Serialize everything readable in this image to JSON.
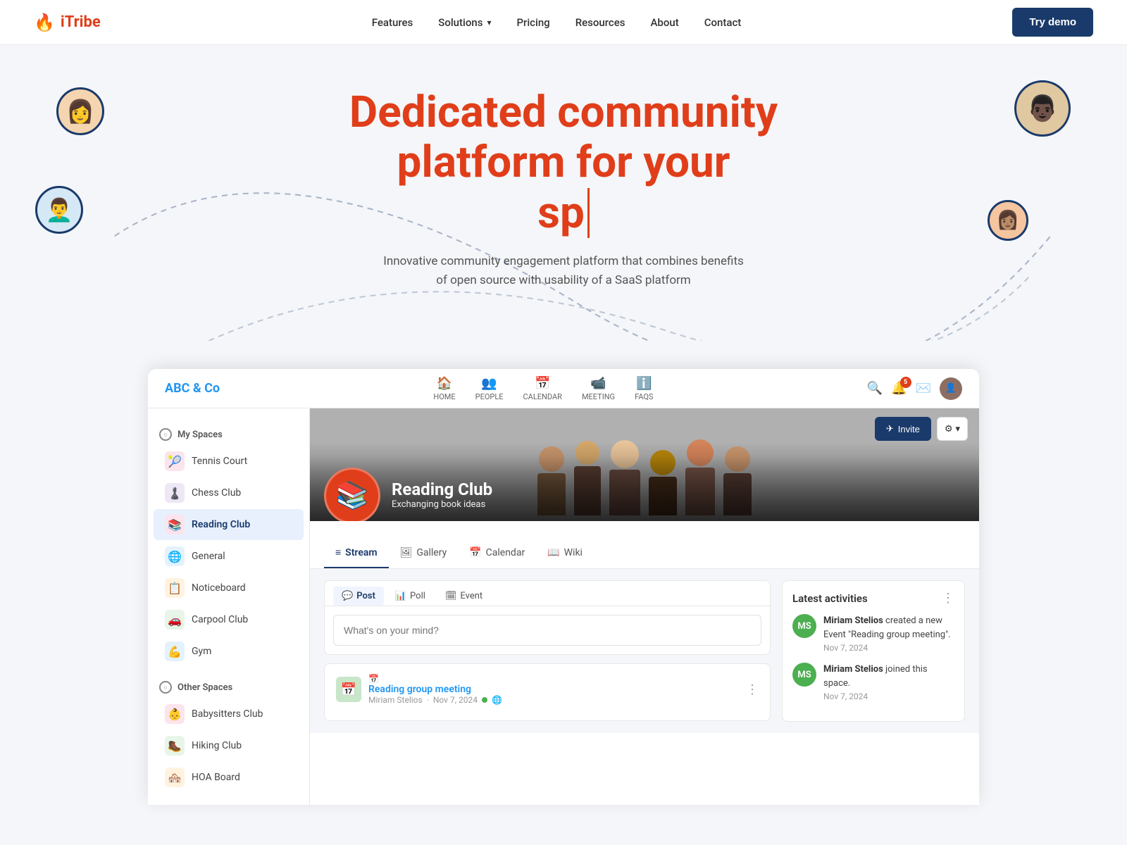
{
  "topnav": {
    "logo_icon": "🔥",
    "logo_text": "iTribe",
    "nav_items": [
      {
        "label": "Features",
        "has_dropdown": false
      },
      {
        "label": "Solutions",
        "has_dropdown": true
      },
      {
        "label": "Pricing",
        "has_dropdown": false
      },
      {
        "label": "Resources",
        "has_dropdown": false
      },
      {
        "label": "About",
        "has_dropdown": false
      },
      {
        "label": "Contact",
        "has_dropdown": false
      }
    ],
    "try_demo_label": "Try demo"
  },
  "hero": {
    "title_line1": "Dedicated community",
    "title_line2": "platform for your",
    "typed_text": "sp",
    "subtitle": "Innovative community engagement platform that combines benefits of open source with usability of a SaaS platform"
  },
  "demo": {
    "brand": "ABC & Co",
    "nav_items": [
      {
        "icon": "🏠",
        "label": "HOME"
      },
      {
        "icon": "👥",
        "label": "PEOPLE"
      },
      {
        "icon": "📅",
        "label": "CALENDAR"
      },
      {
        "icon": "📹",
        "label": "MEETING"
      },
      {
        "icon": "ℹ️",
        "label": "FAQS"
      }
    ],
    "notif_count": "5",
    "sidebar": {
      "my_spaces_label": "My Spaces",
      "items": [
        {
          "label": "Tennis Court",
          "icon": "🎾",
          "bg": "#fce4ec",
          "active": false
        },
        {
          "label": "Chess Club",
          "icon": "♟️",
          "bg": "#ede7f6",
          "active": false
        },
        {
          "label": "Reading Club",
          "icon": "📚",
          "bg": "#fce4ec",
          "active": true
        },
        {
          "label": "General",
          "icon": "🌐",
          "bg": "#e3f2fd",
          "active": false
        },
        {
          "label": "Noticeboard",
          "icon": "📋",
          "bg": "#fff3e0",
          "active": false
        },
        {
          "label": "Carpool Club",
          "icon": "🚗",
          "bg": "#e8f5e9",
          "active": false
        },
        {
          "label": "Gym",
          "icon": "💪",
          "bg": "#e3f2fd",
          "active": false
        }
      ],
      "other_spaces_label": "Other Spaces",
      "other_items": [
        {
          "label": "Babysitters Club",
          "icon": "👶",
          "bg": "#fce4ec"
        },
        {
          "label": "Hiking Club",
          "icon": "🥾",
          "bg": "#e8f5e9"
        },
        {
          "label": "HOA Board",
          "icon": "🏘️",
          "bg": "#fff3e0"
        }
      ]
    },
    "space": {
      "name": "Reading Club",
      "tagline": "Exchanging book ideas",
      "logo_emoji": "📚",
      "invite_label": "Invite",
      "settings_label": "⚙"
    },
    "tabs": [
      {
        "icon": "≡",
        "label": "Stream",
        "active": true
      },
      {
        "icon": "🖼",
        "label": "Gallery",
        "active": false
      },
      {
        "icon": "📅",
        "label": "Calendar",
        "active": false
      },
      {
        "icon": "📖",
        "label": "Wiki",
        "active": false
      }
    ],
    "post_tabs": [
      {
        "icon": "💬",
        "label": "Post",
        "active": true
      },
      {
        "icon": "📊",
        "label": "Poll",
        "active": false
      },
      {
        "icon": "🗓",
        "label": "Event",
        "active": false
      }
    ],
    "post_placeholder": "What's on your mind?",
    "post_card": {
      "icon": "📅",
      "type_label": "Reading group meeting",
      "author": "Miriam Stelios",
      "date": "Nov 7, 2024"
    },
    "latest_activities": {
      "title": "Latest activities",
      "items": [
        {
          "avatar_initials": "MS",
          "avatar_color": "#4caf50",
          "text_before": "Miriam Stelios",
          "text_after": " created a new Event \"Reading group meeting\".",
          "date": "Nov 7, 2024"
        },
        {
          "avatar_initials": "MS",
          "avatar_color": "#4caf50",
          "text_before": "Miriam Stelios",
          "text_after": " joined this space.",
          "date": "Nov 7, 2024"
        }
      ]
    }
  }
}
